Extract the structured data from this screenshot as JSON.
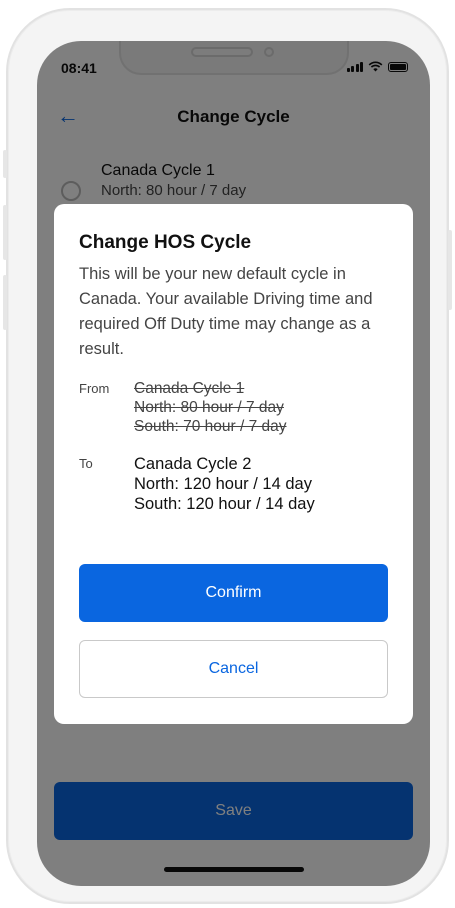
{
  "status_bar": {
    "time": "08:41"
  },
  "nav": {
    "title": "Change Cycle"
  },
  "options": [
    {
      "title": "Canada Cycle 1",
      "subtitle": "North: 80 hour / 7 day"
    }
  ],
  "save_label": "Save",
  "modal": {
    "title": "Change HOS Cycle",
    "body": "This will be your new default cycle in Canada. Your available Driving time and required Off Duty time may change as a result.",
    "from_label": "From",
    "from_lines": [
      "Canada Cycle 1",
      "North: 80 hour / 7 day",
      "South: 70 hour / 7 day"
    ],
    "to_label": "To",
    "to_lines": [
      "Canada Cycle 2",
      "North: 120 hour / 14 day",
      "South: 120 hour / 14 day"
    ],
    "confirm_label": "Confirm",
    "cancel_label": "Cancel"
  },
  "colors": {
    "accent": "#0a66e0",
    "overlay": "rgba(0,0,0,0.5)"
  }
}
